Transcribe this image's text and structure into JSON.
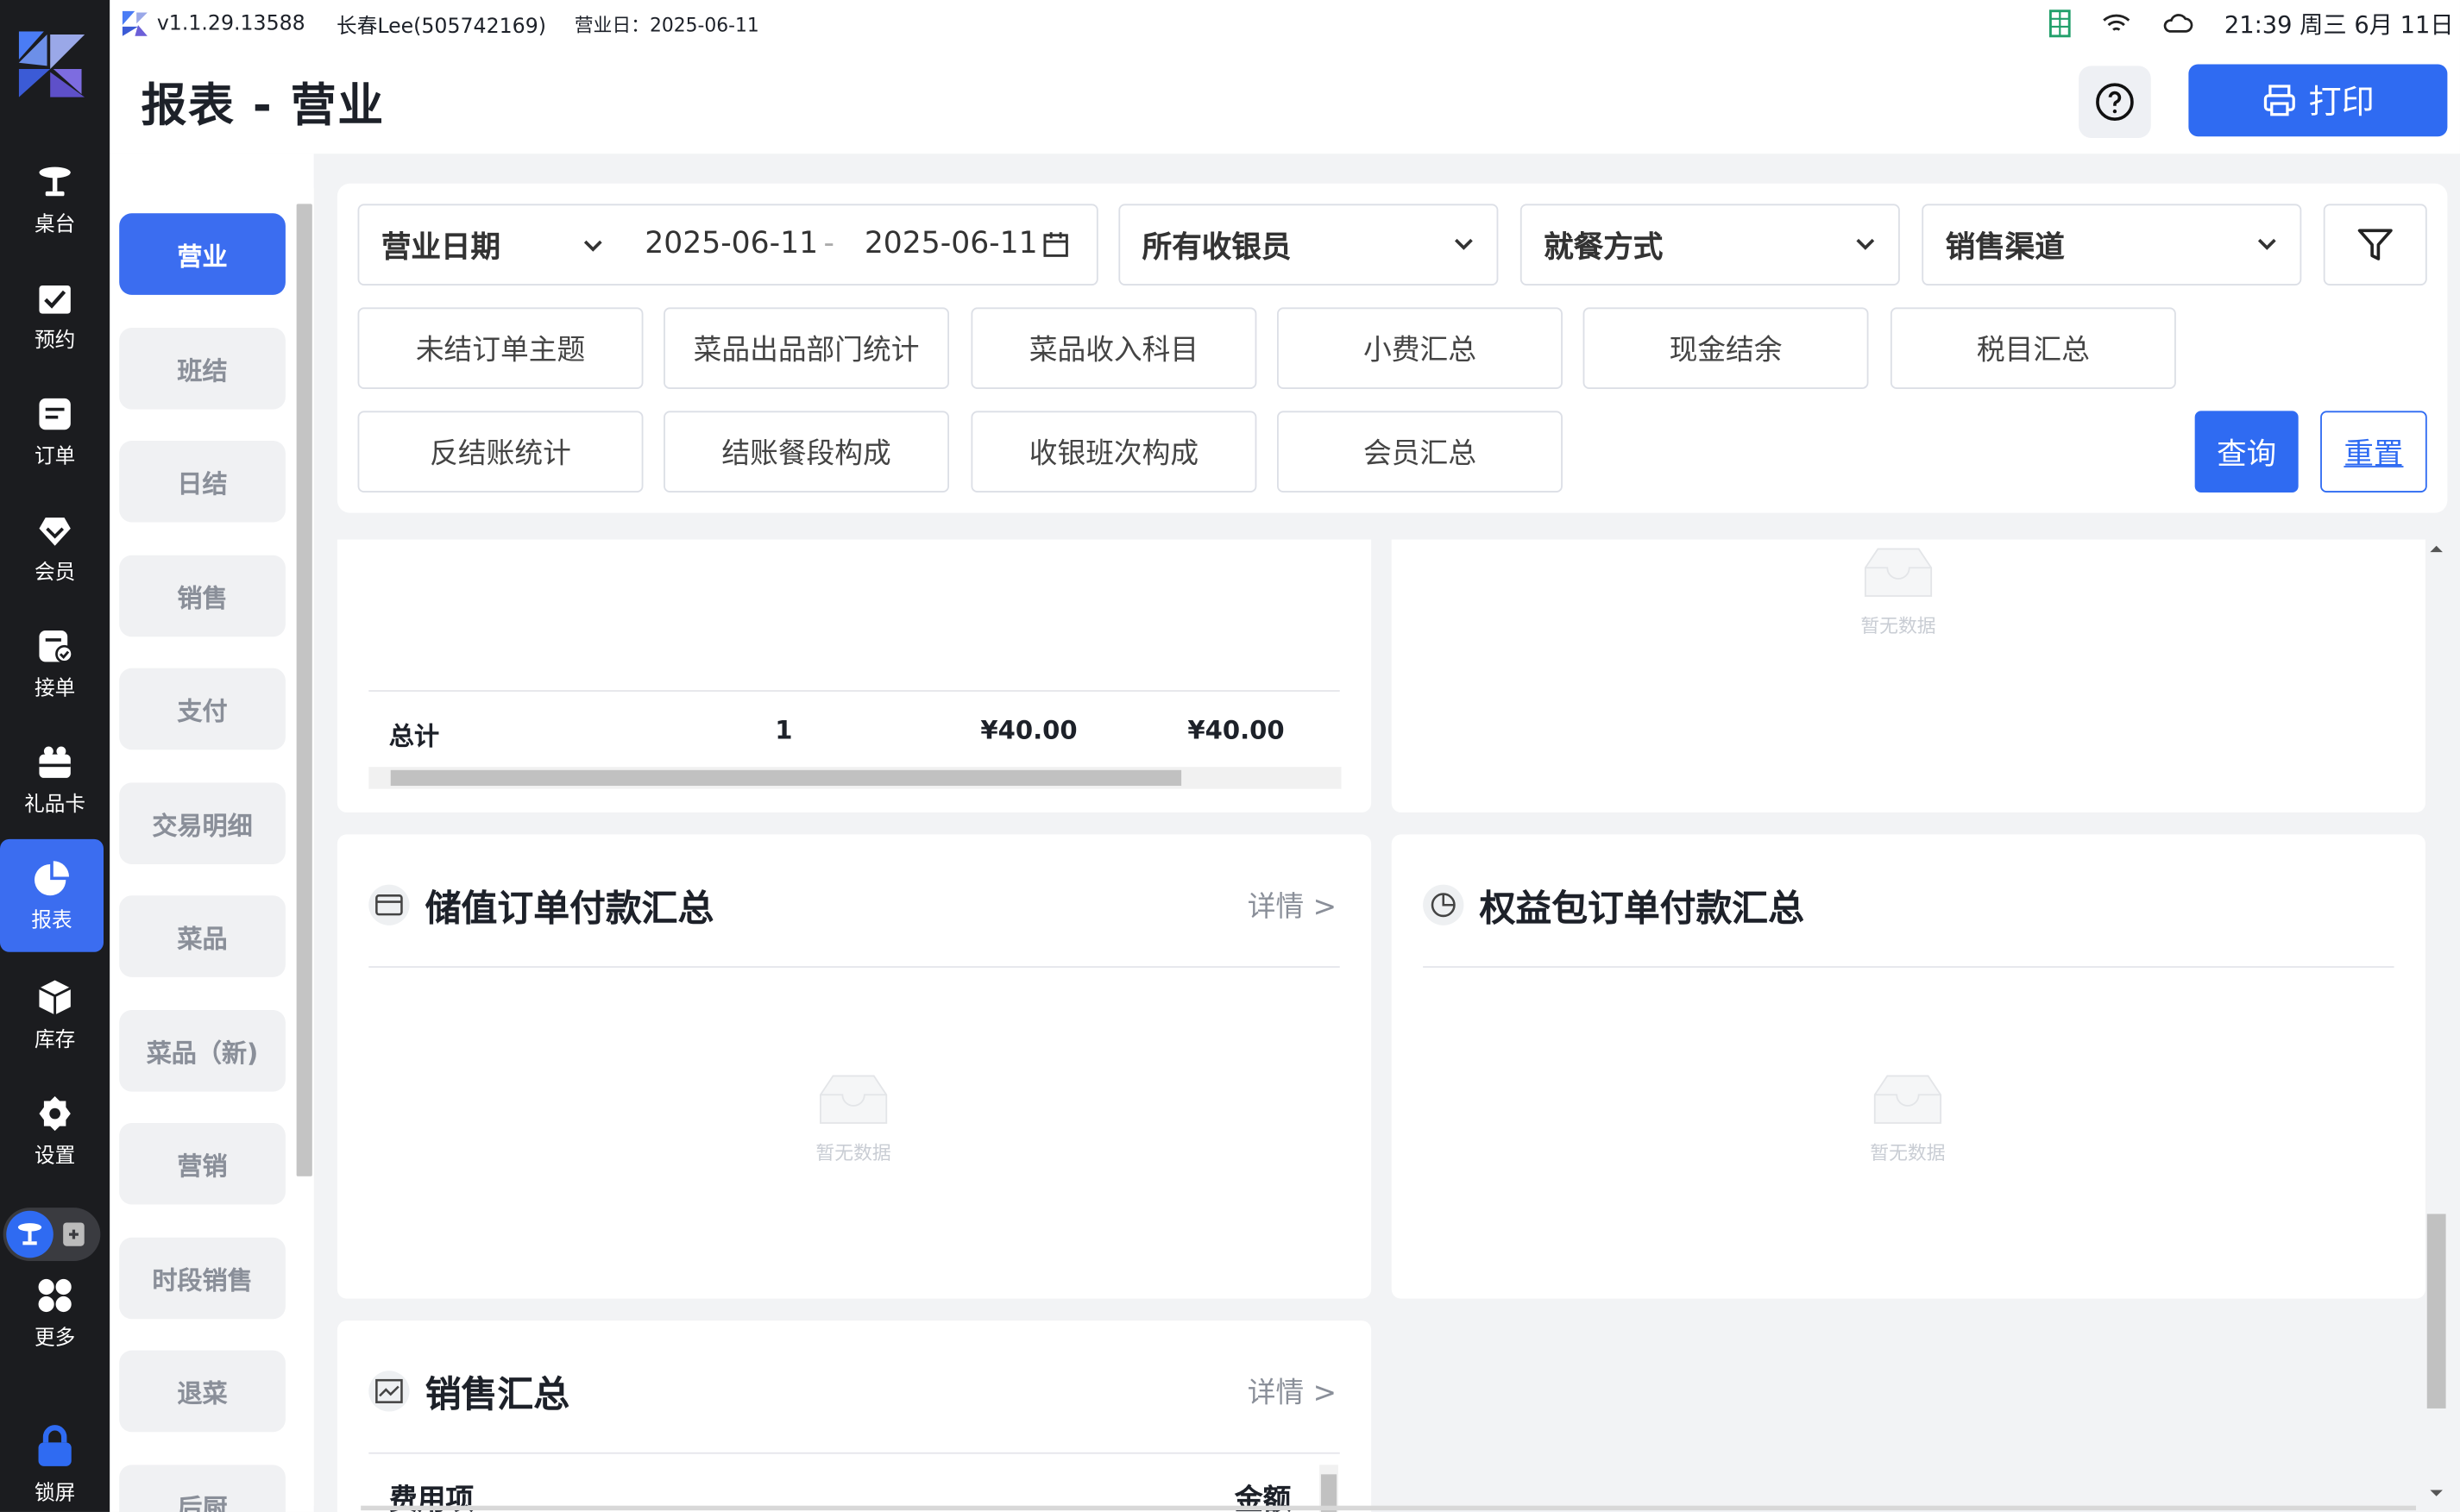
{
  "status_bar": {
    "version": "v1.1.29.13588",
    "user": "长春Lee(505742169)",
    "business_day": "营业日：2025-06-11",
    "clock": "21:39 周三 6月 11日"
  },
  "header": {
    "title": "报表 - 营业",
    "print_label": "打印"
  },
  "nav": {
    "items": [
      {
        "label": "桌台",
        "icon": "table-icon"
      },
      {
        "label": "预约",
        "icon": "calendar-check-icon"
      },
      {
        "label": "订单",
        "icon": "order-icon"
      },
      {
        "label": "会员",
        "icon": "member-icon"
      },
      {
        "label": "接单",
        "icon": "receive-order-icon"
      },
      {
        "label": "礼品卡",
        "icon": "gift-card-icon"
      },
      {
        "label": "报表",
        "icon": "pie-chart-icon",
        "active": true
      },
      {
        "label": "库存",
        "icon": "inventory-icon"
      },
      {
        "label": "设置",
        "icon": "gear-icon"
      },
      {
        "label": "更多",
        "icon": "grid-icon"
      },
      {
        "label": "锁屏",
        "icon": "lock-icon"
      }
    ]
  },
  "subnav": {
    "items": [
      "营业",
      "班结",
      "日结",
      "销售",
      "支付",
      "交易明细",
      "菜品",
      "菜品（新)",
      "营销",
      "时段销售",
      "退菜",
      "后厨"
    ],
    "active_index": 0
  },
  "filters": {
    "date_type": "营业日期",
    "date_start": "2025-06-11",
    "date_sep": "-",
    "date_end": "2025-06-11",
    "cashier": "所有收银员",
    "dining_mode": "就餐方式",
    "channel": "销售渠道",
    "tags_row1": [
      "未结订单主题",
      "菜品出品部门统计",
      "菜品收入科目",
      "小费汇总",
      "现金结余",
      "税目汇总"
    ],
    "tags_row2": [
      "反结账统计",
      "结账餐段构成",
      "收银班次构成",
      "会员汇总"
    ],
    "query_label": "查询",
    "reset_label": "重置"
  },
  "top_left_table": {
    "total_label": "总计",
    "total_count": "1",
    "total_amount1": "¥40.00",
    "total_amount2": "¥40.00"
  },
  "empty_text": "暂无数据",
  "cards": {
    "stored_value": {
      "title": "储值订单付款汇总",
      "detail": "详情 >"
    },
    "benefit_pack": {
      "title": "权益包订单付款汇总"
    },
    "sales_summary": {
      "title": "销售汇总",
      "detail": "详情 >",
      "col1": "费用项",
      "col2": "金额"
    }
  },
  "colors": {
    "accent": "#2f6bf2",
    "nav_bg": "#1b1c1f"
  }
}
